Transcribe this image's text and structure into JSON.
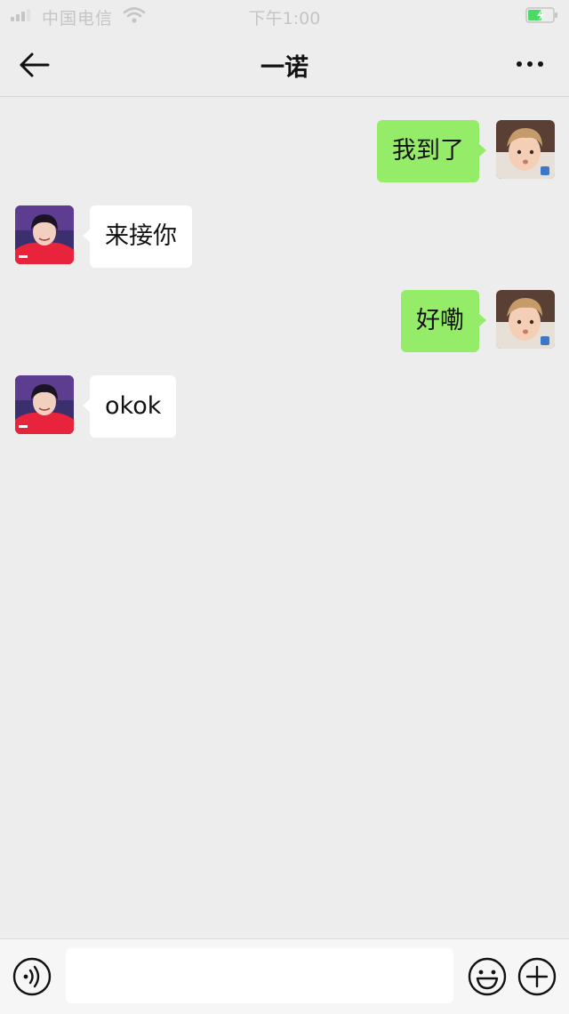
{
  "status_bar": {
    "carrier": "中国电信",
    "time": "下午1:00",
    "signal_icon": "signal-icon",
    "wifi_icon": "wifi-icon",
    "battery_icon": "battery-charging-icon"
  },
  "header": {
    "title": "一诺",
    "back_icon": "back-arrow-icon",
    "more_icon": "more-icon"
  },
  "messages": [
    {
      "direction": "outgoing",
      "text": "我到了"
    },
    {
      "direction": "incoming",
      "text": "来接你"
    },
    {
      "direction": "outgoing",
      "text": "好嘞"
    },
    {
      "direction": "incoming",
      "text": "okok"
    }
  ],
  "input_bar": {
    "value": "",
    "voice_icon": "voice-icon",
    "emoji_icon": "emoji-icon",
    "plus_icon": "plus-icon"
  },
  "colors": {
    "background": "#ededed",
    "outgoing_bubble": "#95ec69",
    "incoming_bubble": "#ffffff"
  }
}
